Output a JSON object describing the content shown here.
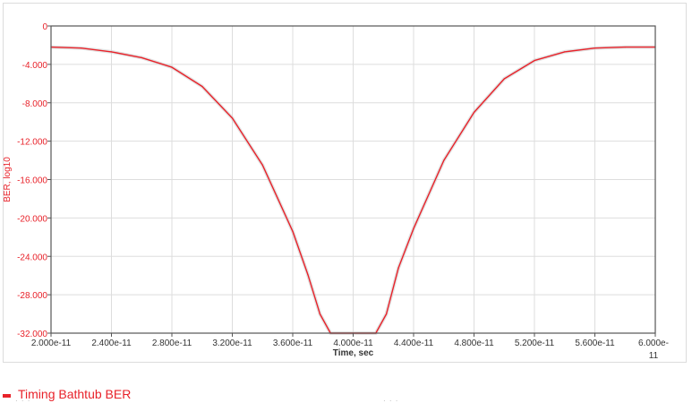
{
  "chart_data": {
    "type": "line",
    "title": "",
    "xlabel": "Time, sec",
    "ylabel": "BER, log10",
    "xlim": [
      2e-11,
      6e-11
    ],
    "ylim": [
      -32,
      0
    ],
    "x_ticks": [
      2e-11,
      2.4e-11,
      2.8e-11,
      3.2e-11,
      3.6e-11,
      4e-11,
      4.4e-11,
      4.8e-11,
      5.2e-11,
      5.6e-11,
      6e-11
    ],
    "x_tick_labels": [
      "2.000e-11",
      "2.400e-11",
      "2.800e-11",
      "3.200e-11",
      "3.600e-11",
      "4.000e-11",
      "4.400e-11",
      "4.800e-11",
      "5.200e-11",
      "5.600e-11",
      "6.000e-11"
    ],
    "y_ticks": [
      0,
      -4,
      -8,
      -12,
      -16,
      -20,
      -24,
      -28,
      -32
    ],
    "y_tick_labels": [
      "0",
      "-4.000",
      "-8.000",
      "-12.000",
      "-16.000",
      "-20.000",
      "-24.000",
      "-28.000",
      "-32.000"
    ],
    "grid": true,
    "legend_position": "bottom-left",
    "series": [
      {
        "name": "Timing Bathtub BER",
        "color": "#e8222a",
        "x": [
          2e-11,
          2.2e-11,
          2.4e-11,
          2.6e-11,
          2.8e-11,
          3e-11,
          3.2e-11,
          3.4e-11,
          3.6e-11,
          3.7e-11,
          3.78e-11,
          3.85e-11,
          4e-11,
          4.15e-11,
          4.22e-11,
          4.3e-11,
          4.4e-11,
          4.6e-11,
          4.8e-11,
          5e-11,
          5.2e-11,
          5.4e-11,
          5.6e-11,
          5.8e-11,
          6e-11
        ],
        "y": [
          -2.2,
          -2.3,
          -2.7,
          -3.3,
          -4.3,
          -6.3,
          -9.6,
          -14.5,
          -21.4,
          -25.9,
          -30.0,
          -32.0,
          -32.0,
          -32.0,
          -30.0,
          -25.2,
          -21.1,
          -14.0,
          -9.0,
          -5.5,
          -3.6,
          -2.7,
          -2.3,
          -2.2,
          -2.2
        ]
      }
    ]
  },
  "legend": {
    "label": "Timing Bathtub BER",
    "color": "#e8222a"
  },
  "colors": {
    "axis_label": "#e8222a",
    "grid": "#dddddd",
    "axis": "#555555"
  }
}
